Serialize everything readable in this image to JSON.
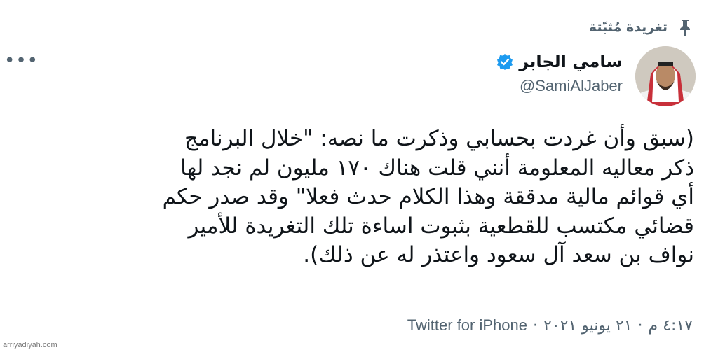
{
  "pinned": {
    "label": "تغريدة مُثبّتة",
    "icon": "pin-icon"
  },
  "menu": {
    "icon": "more-icon",
    "glyph": "•••"
  },
  "author": {
    "display_name": "سامي الجابر",
    "handle": "@SamiAlJaber",
    "verified": true,
    "verified_color": "#1d9bf0",
    "avatar_icon": "avatar"
  },
  "tweet": {
    "lines": [
      "(سبق وأن غردت بحسابي وذكرت ما نصه: \"خلال البرنامج",
      "ذكر معاليه المعلومة أنني قلت هناك ١٧٠ مليون لم نجد لها",
      "أي قوائم مالية مدققة وهذا الكلام حدث فعلا\" وقد صدر حكم",
      "قضائي مكتسب للقطعية بثبوت اساءة تلك التغريدة للأمير",
      "نواف بن سعد آل سعود واعتذر له عن ذلك)."
    ]
  },
  "meta": {
    "time": "٤:١٧ م",
    "date": "٢١ يونيو ٢٠٢١",
    "separator": "·",
    "source": "Twitter for iPhone"
  },
  "watermark": "arriyadiyah.com",
  "colors": {
    "text": "#0f1419",
    "secondary": "#536471",
    "background": "#ffffff"
  }
}
